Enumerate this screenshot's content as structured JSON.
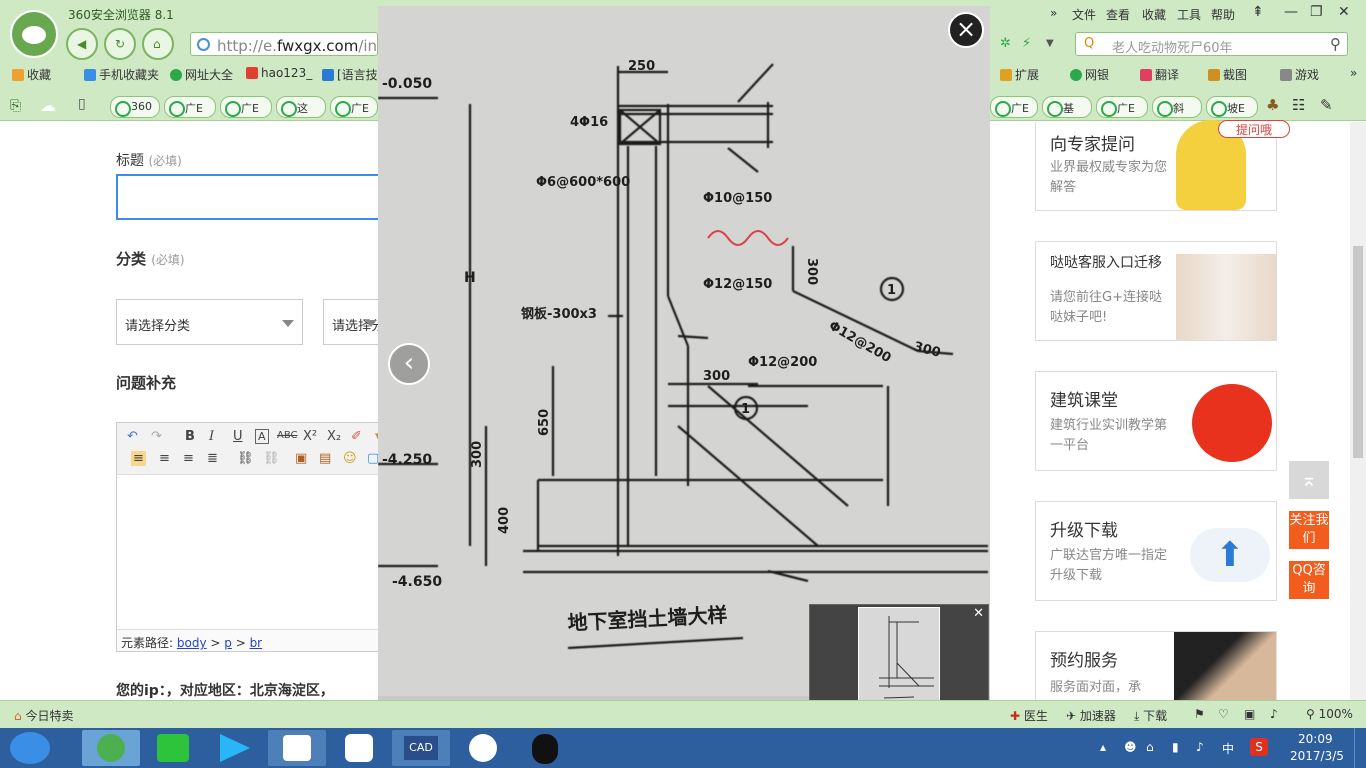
{
  "browser": {
    "title": "360安全浏览器 8.1",
    "url_prefix": "http://e.",
    "url_domain": "fwxgx.com",
    "url_suffix": "/in",
    "search_placeholder": "老人吃动物死尸60年",
    "menu": [
      "文件",
      "查看",
      "收藏",
      "工具",
      "帮助"
    ],
    "bookmarks_left": [
      "收藏",
      "手机收藏夹",
      "网址大全",
      "hao123_",
      "[语言技"
    ],
    "bookmarks_right": [
      "扩展",
      "网银",
      "翻译",
      "截图",
      "游戏"
    ],
    "tabs_left": [
      "360",
      "广E",
      "广E",
      "这",
      "广E"
    ],
    "tabs_right": [
      "广E",
      "基",
      "广E",
      "斜",
      "坡E"
    ]
  },
  "form": {
    "title_label": "标题",
    "title_required": "(必填)",
    "category_label": "分类",
    "category_required": "(必填)",
    "category_select_1": "请选择分类",
    "category_select_2": "请选择分",
    "supplement_label": "问题补充",
    "element_path_label": "元素路径:",
    "path_body": "body",
    "path_p": "p",
    "path_br": "br",
    "ip_text": "您的ip：，对应地区：北京海淀区，"
  },
  "sidebar": {
    "cards": [
      {
        "title": "向专家提问",
        "desc": "业界最权威专家为您解答",
        "badge": "提问哦"
      },
      {
        "title": "哒哒客服入口迁移",
        "desc": "请您前往G+连接哒哒妹子吧!"
      },
      {
        "title": "建筑课堂",
        "desc": "建筑行业实训教学第一平台"
      },
      {
        "title": "升级下载",
        "desc": "广联达官方唯一指定升级下载"
      },
      {
        "title": "预约服务",
        "desc": "服务面对面，承"
      }
    ],
    "follow_us": "关注我们",
    "qq_consult": "QQ咨询"
  },
  "viewer": {
    "drawing_caption": "地下室挡土墙大样",
    "dims": [
      "250",
      "4Φ16",
      "Φ6@600*600",
      "Φ10@150",
      "Φ12@150",
      "钢板-300x3",
      "300",
      "Φ12@200",
      "Φ12@200",
      "300",
      "300",
      "650",
      "300",
      "400",
      "-0.050",
      "-4.250",
      "-4.650",
      "H",
      "1",
      "1"
    ]
  },
  "statusbar": {
    "today": "今日特卖",
    "items": [
      "医生",
      "加速器",
      "下载"
    ],
    "zoom": "100%"
  },
  "taskbar": {
    "time": "20:09",
    "date": "2017/3/5",
    "lang": "中"
  }
}
